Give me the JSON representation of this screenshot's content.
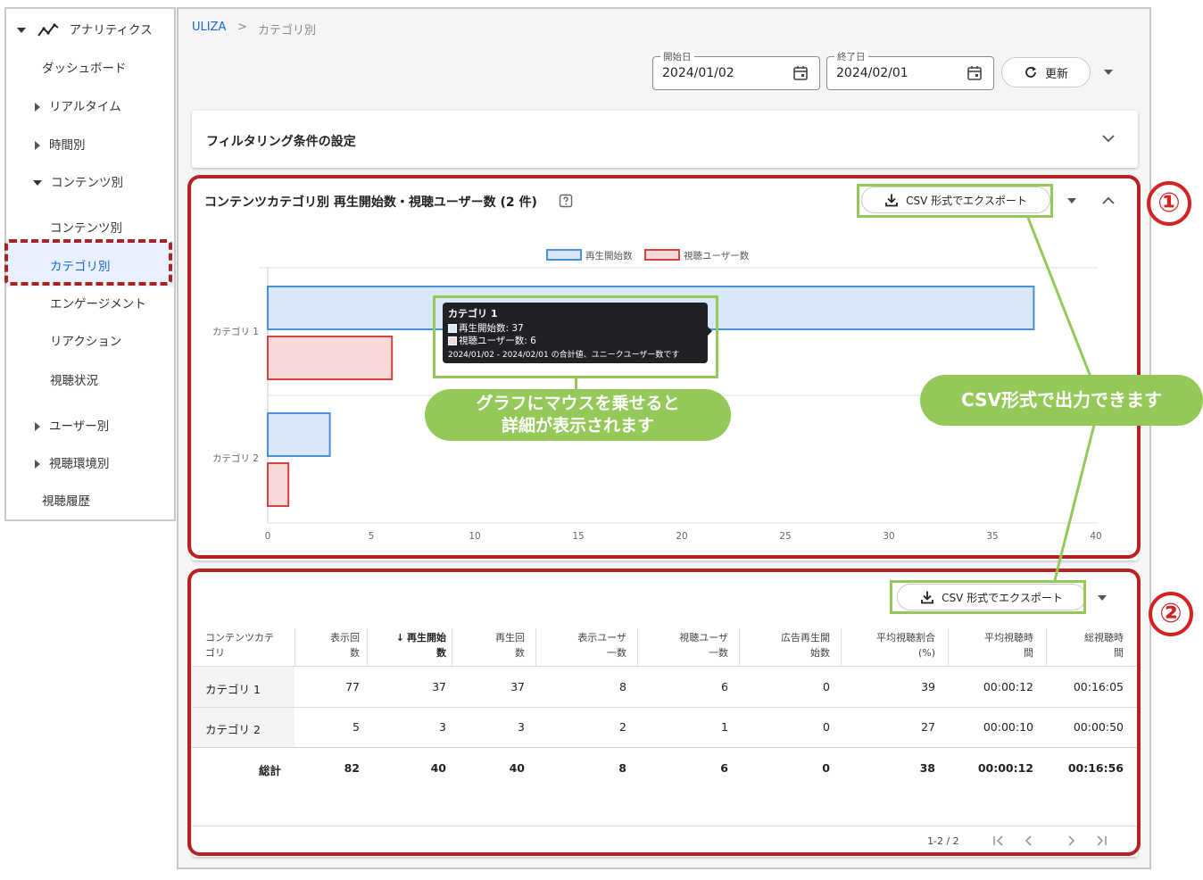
{
  "sidebar": {
    "section_title": "アナリティクス",
    "items": [
      {
        "label": "ダッシュボード"
      },
      {
        "label": "リアルタイム"
      },
      {
        "label": "時間別"
      },
      {
        "label": "コンテンツ別"
      },
      {
        "label": "コンテンツ別"
      },
      {
        "label": "カテゴリ別"
      },
      {
        "label": "エンゲージメント"
      },
      {
        "label": "リアクション"
      },
      {
        "label": "視聴状況"
      },
      {
        "label": "ユーザー別"
      },
      {
        "label": "視聴環境別"
      },
      {
        "label": "視聴履歴"
      }
    ]
  },
  "breadcrumb": {
    "root": "ULIZA",
    "separator": ">",
    "current": "カテゴリ別"
  },
  "date_range": {
    "start_label": "開始日",
    "start_value": "2024/01/02",
    "end_label": "終了日",
    "end_value": "2024/02/01"
  },
  "refresh_label": "更新",
  "filter": {
    "title": "フィルタリング条件の設定"
  },
  "chart_card": {
    "title": "コンテンツカテゴリ別 再生開始数・視聴ユーザー数 (2 件)",
    "export_label": "CSV 形式でエクスポート"
  },
  "chart_data": {
    "type": "bar",
    "orientation": "horizontal",
    "categories": [
      "カテゴリ 1",
      "カテゴリ 2"
    ],
    "series": [
      {
        "name": "再生開始数",
        "values": [
          37,
          3
        ],
        "color": "#4a8fd8",
        "fill": "#d9e8f8"
      },
      {
        "name": "視聴ユーザー数",
        "values": [
          6,
          1
        ],
        "color": "#d94040",
        "fill": "#f8d9d9"
      }
    ],
    "xlim": [
      0,
      40
    ],
    "xticks": [
      0,
      5,
      10,
      15,
      20,
      25,
      30,
      35,
      40
    ],
    "legend_position": "top",
    "grid": true
  },
  "tooltip": {
    "title": "カテゴリ 1",
    "line1": "再生開始数: 37",
    "line2": "視聴ユーザー数: 6",
    "note": "2024/01/02 - 2024/02/01 の合計値、ユニークユーザー数です"
  },
  "annotations": {
    "hover_callout_1": "グラフにマウスを乗せると",
    "hover_callout_2": "詳細が表示されます",
    "csv_callout": "CSV形式で出力できます",
    "num1": "①",
    "num2": "②"
  },
  "table_card": {
    "export_label": "CSV 形式でエクスポート",
    "headers": [
      [
        "コンテンツカテ",
        "ゴリ"
      ],
      [
        "表示回",
        "数"
      ],
      [
        "再生開始",
        "数"
      ],
      [
        "再生回",
        "数"
      ],
      [
        "表示ユーザ",
        "一数"
      ],
      [
        "視聴ユーザ",
        "一数"
      ],
      [
        "広告再生開",
        "始数"
      ],
      [
        "平均視聴割合",
        "(%)"
      ],
      [
        "平均視聴時",
        "間"
      ],
      [
        "総視聴時",
        "間"
      ]
    ],
    "rows": [
      [
        "カテゴリ 1",
        "77",
        "37",
        "37",
        "8",
        "6",
        "0",
        "39",
        "00:00:12",
        "00:16:05"
      ],
      [
        "カテゴリ 2",
        "5",
        "3",
        "3",
        "2",
        "1",
        "0",
        "27",
        "00:00:10",
        "00:00:50"
      ]
    ],
    "total": [
      "総計",
      "82",
      "40",
      "40",
      "8",
      "6",
      "0",
      "38",
      "00:00:12",
      "00:16:56"
    ],
    "pagination": "1-2 / 2"
  }
}
